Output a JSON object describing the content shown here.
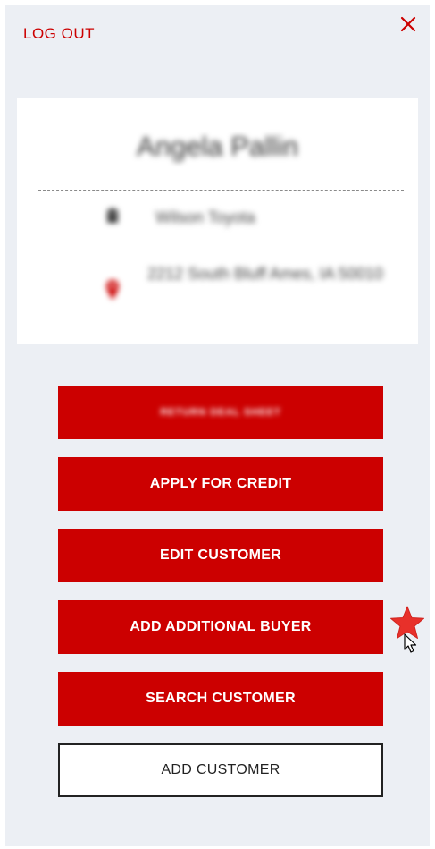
{
  "header": {
    "logout_label": "LOG OUT",
    "close_icon": "close-icon"
  },
  "customer_card": {
    "name": "Angela Pallin",
    "dealer": "Wilson Toyota",
    "address": "2212 South Bluff Ames, IA 50010"
  },
  "actions": {
    "primary_hidden_label": "RETURN DEAL SHEET",
    "apply_credit_label": "APPLY FOR CREDIT",
    "edit_customer_label": "EDIT CUSTOMER",
    "add_buyer_label": "ADD ADDITIONAL BUYER",
    "search_customer_label": "SEARCH CUSTOMER",
    "add_customer_label": "ADD CUSTOMER"
  },
  "colors": {
    "accent": "#cc0000",
    "panel_bg": "#eceff4",
    "card_bg": "#ffffff",
    "star": "#e8302a"
  }
}
